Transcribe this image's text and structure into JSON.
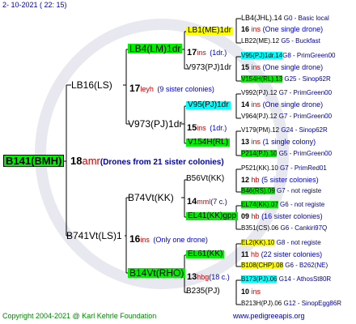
{
  "header": {
    "date": "2- 10-2021 ( 22: 15)"
  },
  "footer": {
    "copyright": "Copyright 2004-2021 @ Karl Kehrle Foundation",
    "site": "www.pedigreeapis.org"
  },
  "colors": {
    "green": "#00ff00",
    "yellow": "#ffff00",
    "cyan": "#00ffff",
    "orange": "#ffaa00"
  },
  "root": {
    "name": "B141(BMH)",
    "num": "18",
    "abbr": "amr",
    "note": "(Drones from 21 sister colonies)"
  },
  "gen1": {
    "sire": {
      "name": "LB16(LS)",
      "num": "17",
      "abbr": "leyh",
      "note": "(9 sister colonies)"
    },
    "dam": {
      "name": "B741Vt(LS)1",
      "num": "16",
      "abbr": "ins",
      "note": "(Only one drone)"
    }
  },
  "gen2": {
    "a": {
      "name": "LB4(LM)1dr",
      "num": "17",
      "abbr": "ins",
      "note": "(1dr.)"
    },
    "b": {
      "name": "V973(PJ)1dr",
      "num": "15",
      "abbr": "ins",
      "note": "(1dr.)"
    },
    "c": {
      "name": "B74Vt(KK)",
      "num": "14",
      "abbr": "mml",
      "note": "(7 c.)"
    },
    "d": {
      "name": "B14Vt(RHO)",
      "num": "13",
      "abbr": "hbg",
      "note": "(18 c.)"
    }
  },
  "gen3": {
    "a": {
      "name": "LB1(ME)1dr",
      "num": "17",
      "abbr": "ins",
      "note": "(1dr.)"
    },
    "b": {
      "name": "V973(PJ)1dr"
    },
    "c": {
      "name": "V95(PJ)1dr",
      "num": "14",
      "abbr": "ins",
      "note": "(One single drone)"
    },
    "d": {
      "name": "V154H(RL)",
      "num": "13",
      "abbr": "ins",
      "note": "(1 single colony)"
    },
    "e": {
      "name": "B56Vt(KK)",
      "num": "12",
      "abbr": "hb",
      "note": "(5 sister colonies)"
    },
    "f": {
      "name": "EL41(KK)gpp",
      "num": "09",
      "abbr": "hb",
      "note": "(16 sister colonies)"
    },
    "g": {
      "name": "EL61(KK)",
      "num": "11",
      "abbr": "hb",
      "note": "(22 sister colonies)"
    },
    "h": {
      "name": "B235(PJ)",
      "num": "10",
      "abbr": "ins",
      "note": ""
    }
  },
  "gen4": [
    {
      "name": "LB4(JHL).14",
      "info": "G0 - Basic local"
    },
    {
      "name": "16",
      "abbr": "ins",
      "note": "(One single drone)"
    },
    {
      "name": "LB22(ME).12",
      "info": "G5 - Buckfast"
    },
    {
      "name": "V95(PJ)1dr.14",
      "info": "G8 - PrimGreen00"
    },
    {
      "name": "15",
      "abbr": "ins",
      "note": "(One single drone)"
    },
    {
      "name": "V154H(RL).13",
      "info": "G25 - Sinop62R"
    },
    {
      "name": "V992(PJ).12",
      "info": "G7 - PrimGreen00"
    },
    {
      "name": "14",
      "abbr": "ins",
      "note": "(One single drone)"
    },
    {
      "name": "V964(PJ).12",
      "info": "G7 - PrimGreen00"
    },
    {
      "name": "V179(PM).12",
      "info": "G24 - Sinop62R"
    },
    {
      "name": "13",
      "abbr": "ins",
      "note": "(1 single colony)"
    },
    {
      "name": "P214(PJ).10",
      "info": "G5 - PrimGreen00"
    },
    {
      "name": "P521(KK).10",
      "info": "G7 - PrimRed01"
    },
    {
      "name": "12",
      "abbr": "hb",
      "note": "(5 sister colonies)"
    },
    {
      "name": "B46(RS).09",
      "info": "G7 - not registe"
    },
    {
      "name": "EL74(KK).07",
      "info": "G6 - not registe"
    },
    {
      "name": "09",
      "abbr": "hb",
      "note": "(16 sister colonies)"
    },
    {
      "name": "B351(CS).06",
      "info": "G6 - Cankiri97Q"
    },
    {
      "name": "EL2(KK).10",
      "info": "G8 - not registe"
    },
    {
      "name": "11",
      "abbr": "hb",
      "note": "(22 sister colonies)"
    },
    {
      "name": "B108(CHP).08",
      "info": "G6 - B262(NE)"
    },
    {
      "name": "B173(PJ).06",
      "info": "G14 - AthosSt80R"
    },
    {
      "name": "10",
      "abbr": "ins",
      "note": ""
    },
    {
      "name": "B213H(PJ).06",
      "info": "G12 - SinopEgg86R"
    }
  ]
}
